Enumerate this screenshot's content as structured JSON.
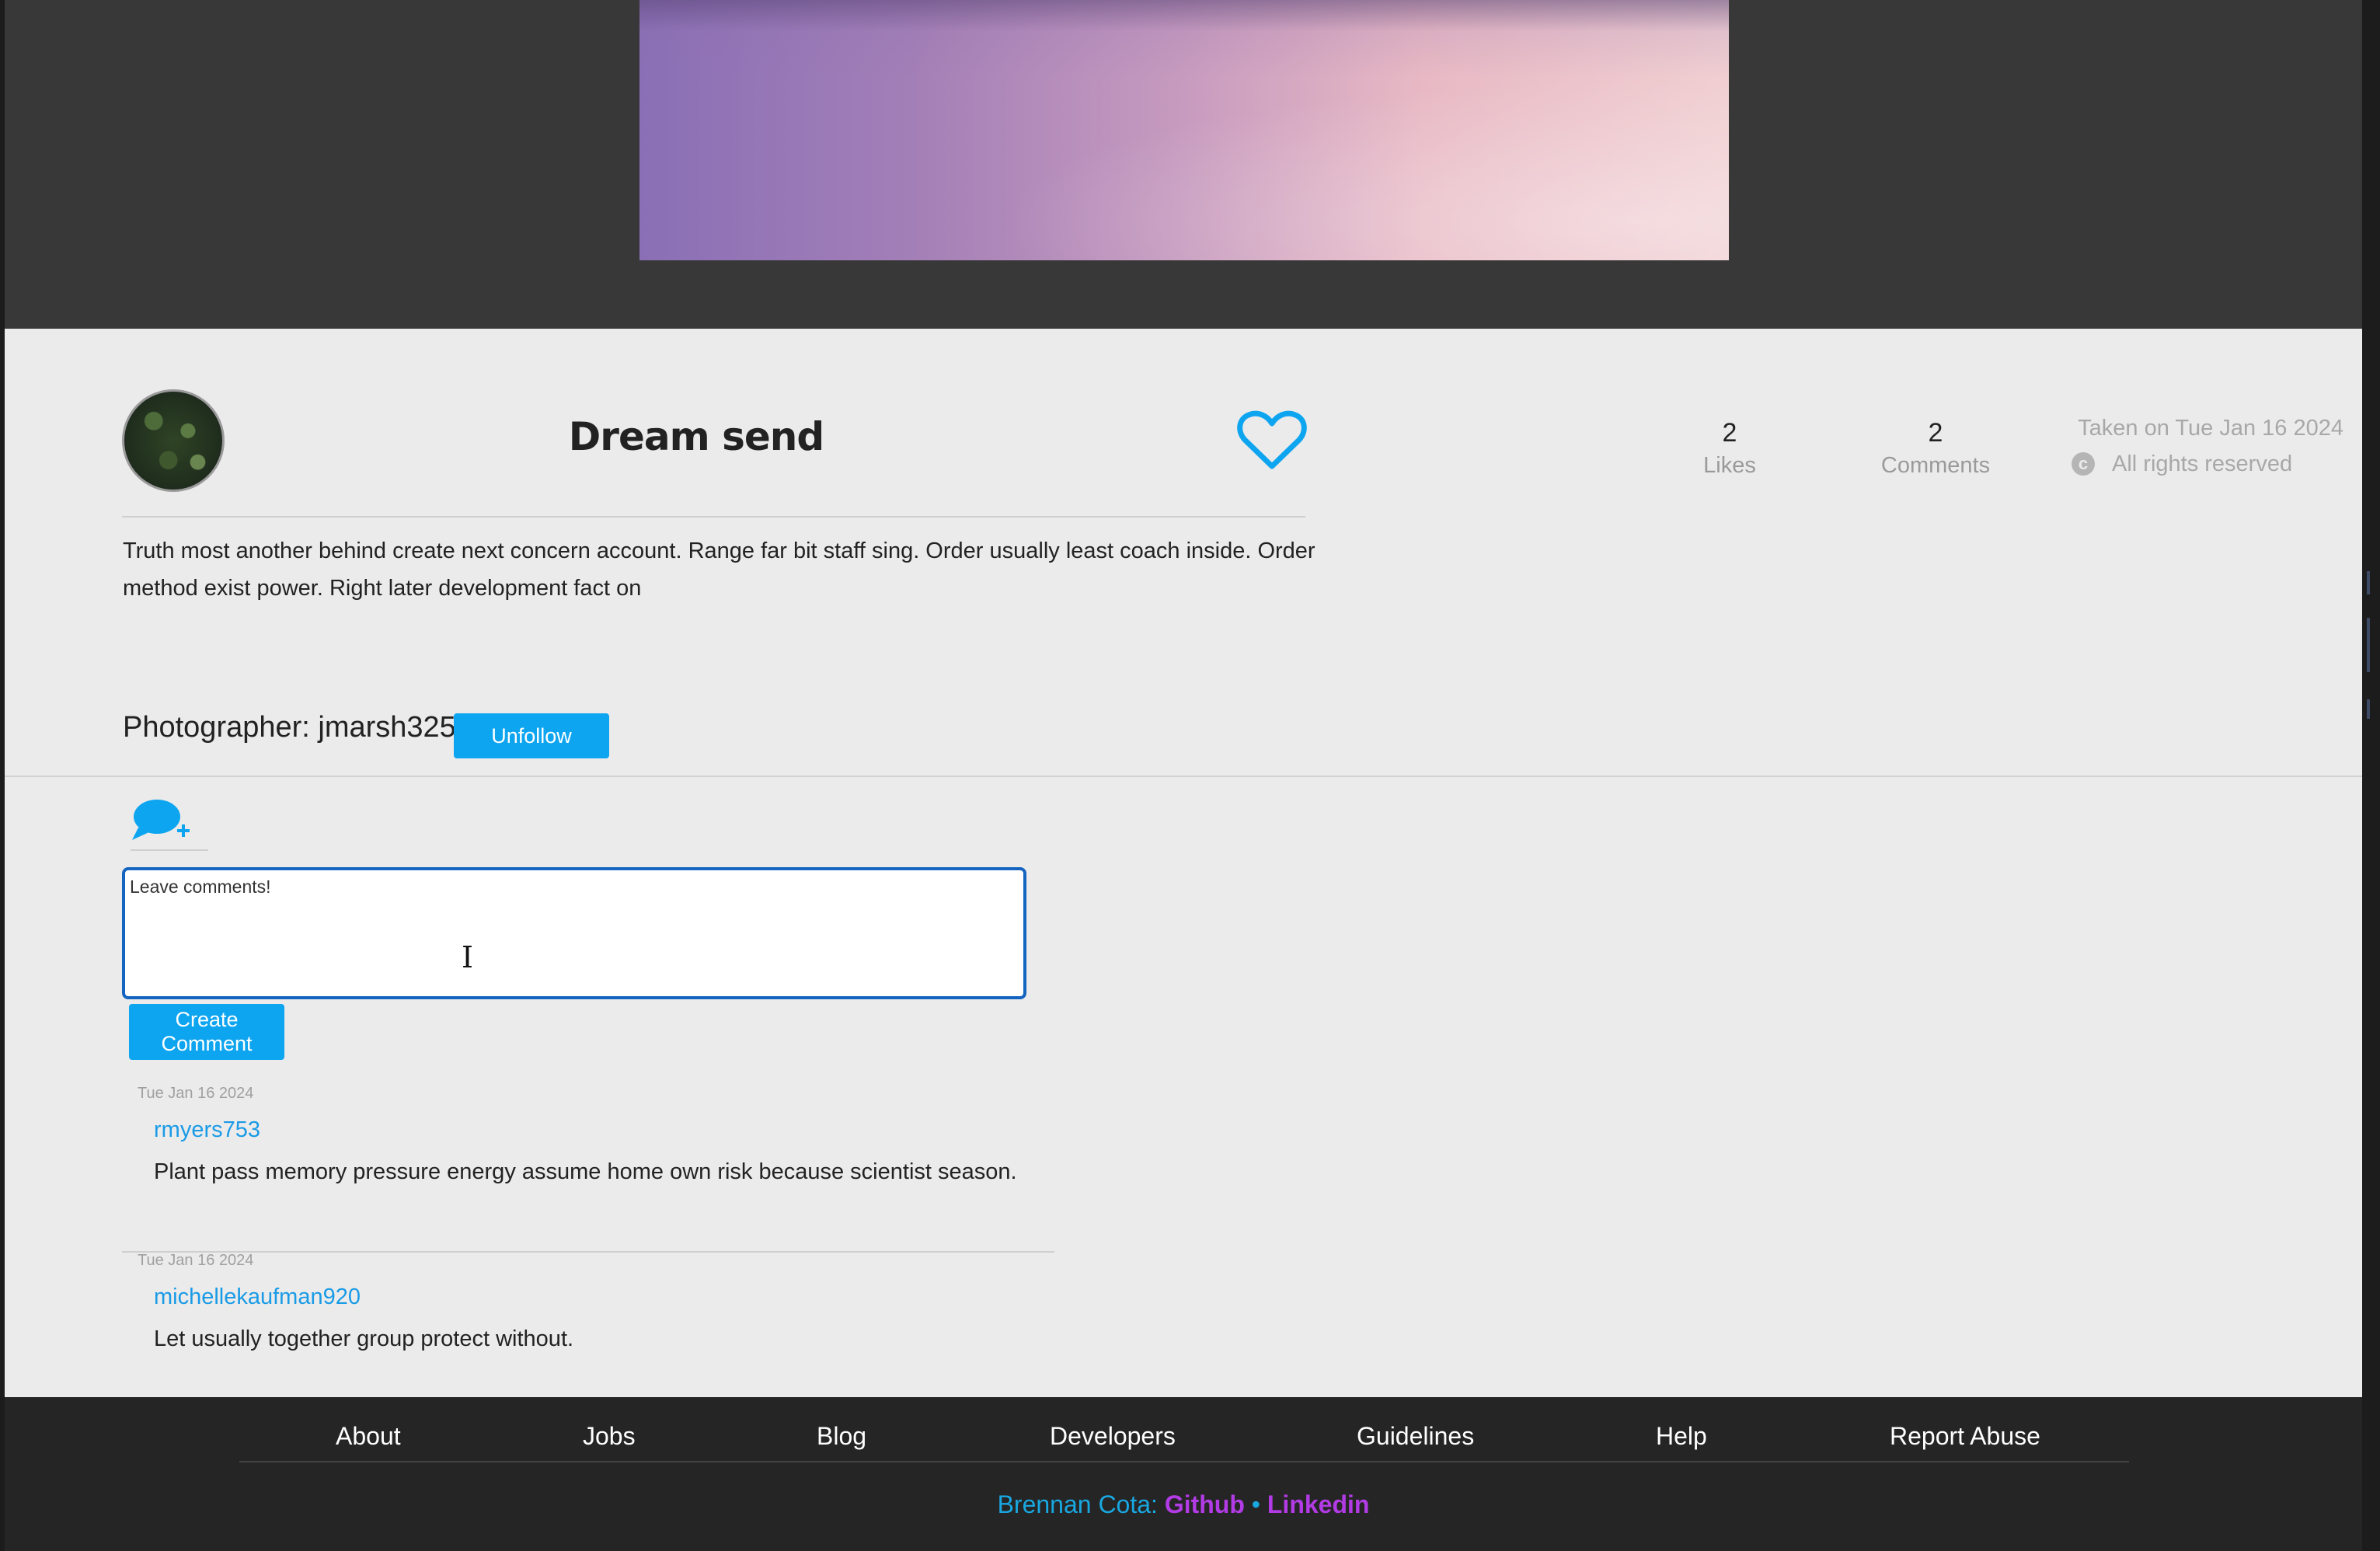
{
  "photo": {
    "name": "main-photo"
  },
  "post": {
    "title": "Dream send",
    "likes_count": "2",
    "likes_label": "Likes",
    "comments_count": "2",
    "comments_label": "Comments",
    "taken": "Taken on Tue Jan 16 2024",
    "rights": "All rights reserved",
    "rights_icon": "copyright-icon",
    "like_icon": "heart-icon",
    "description": "Truth most another behind create next concern account. Range far bit staff sing. Order usually least coach inside. Order method exist power. Right later development fact on",
    "photographer_label": "Photographer: jmarsh325",
    "unfollow_label": "Unfollow"
  },
  "comment_form": {
    "icon": "add-comment-icon",
    "value": "Leave comments!",
    "submit_label": "Create Comment"
  },
  "comments": [
    {
      "date": "Tue Jan 16 2024",
      "user": "rmyers753",
      "text": "Plant pass memory pressure energy assume home own risk because scientist season."
    },
    {
      "date": "Tue Jan 16 2024",
      "user": "michellekaufman920",
      "text": "Let usually together group protect without."
    }
  ],
  "footer": {
    "links": [
      "About",
      "Jobs",
      "Blog",
      "Developers",
      "Guidelines",
      "Help",
      "Report Abuse"
    ],
    "credit_name": "Brennan Cota:",
    "github": "Github",
    "separator": "•",
    "linkedin": "Linkedin"
  },
  "colors": {
    "accent": "#0ea5f0",
    "link": "#1a9be6",
    "footer_link": "#b23be6",
    "focus": "#1565c0"
  }
}
